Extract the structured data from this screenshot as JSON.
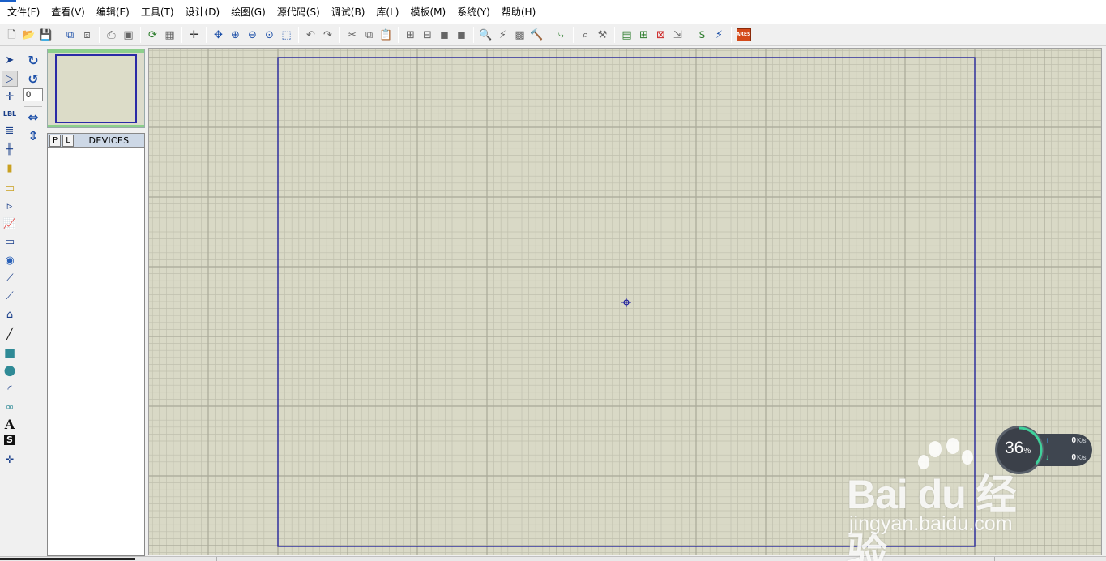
{
  "menu": {
    "items": [
      "文件(F)",
      "查看(V)",
      "编辑(E)",
      "工具(T)",
      "设计(D)",
      "绘图(G)",
      "源代码(S)",
      "调试(B)",
      "库(L)",
      "模板(M)",
      "系统(Y)",
      "帮助(H)"
    ]
  },
  "toolbar": {
    "groups": [
      [
        {
          "name": "new-file-icon",
          "glyph": "🗋",
          "color": "gray"
        },
        {
          "name": "open-folder-icon",
          "glyph": "📂",
          "color": ""
        },
        {
          "name": "save-icon",
          "glyph": "💾",
          "color": "blue"
        }
      ],
      [
        {
          "name": "import-section-icon",
          "glyph": "⧉",
          "color": "blue"
        },
        {
          "name": "export-section-icon",
          "glyph": "⧈",
          "color": "gray"
        }
      ],
      [
        {
          "name": "print-icon",
          "glyph": "⎙",
          "color": "gray"
        },
        {
          "name": "print-area-icon",
          "glyph": "▣",
          "color": "gray"
        }
      ],
      [
        {
          "name": "refresh-icon",
          "glyph": "⟳",
          "color": "green"
        },
        {
          "name": "grid-icon",
          "glyph": "▦",
          "color": "gray"
        }
      ],
      [
        {
          "name": "origin-icon",
          "glyph": "✛",
          "color": ""
        }
      ],
      [
        {
          "name": "pan-icon",
          "glyph": "✥",
          "color": "blue"
        },
        {
          "name": "zoom-in-icon",
          "glyph": "⊕",
          "color": "blue"
        },
        {
          "name": "zoom-out-icon",
          "glyph": "⊖",
          "color": "blue"
        },
        {
          "name": "zoom-all-icon",
          "glyph": "⊙",
          "color": "blue"
        },
        {
          "name": "zoom-area-icon",
          "glyph": "⬚",
          "color": "blue"
        }
      ],
      [
        {
          "name": "undo-icon",
          "glyph": "↶",
          "color": "gray"
        },
        {
          "name": "redo-icon",
          "glyph": "↷",
          "color": "gray"
        }
      ],
      [
        {
          "name": "cut-icon",
          "glyph": "✂",
          "color": "gray"
        },
        {
          "name": "copy-icon",
          "glyph": "⧉",
          "color": "gray"
        },
        {
          "name": "paste-icon",
          "glyph": "📋",
          "color": "gray"
        }
      ],
      [
        {
          "name": "block-copy-icon",
          "glyph": "⊞",
          "color": "gray"
        },
        {
          "name": "block-move-icon",
          "glyph": "⊟",
          "color": "gray"
        },
        {
          "name": "block-rotate-icon",
          "glyph": "◼",
          "color": "gray"
        },
        {
          "name": "block-delete-icon",
          "glyph": "◼",
          "color": "gray"
        }
      ],
      [
        {
          "name": "pick-device-icon",
          "glyph": "🔍",
          "color": "gray"
        },
        {
          "name": "make-device-icon",
          "glyph": "⚡",
          "color": "gray"
        },
        {
          "name": "packaging-icon",
          "glyph": "▩",
          "color": "gray"
        },
        {
          "name": "decompose-icon",
          "glyph": "🔨",
          "color": "gray"
        }
      ],
      [
        {
          "name": "wire-autorouter-icon",
          "glyph": "⤷",
          "color": "green"
        }
      ],
      [
        {
          "name": "search-tag-icon",
          "glyph": "⌕",
          "color": ""
        },
        {
          "name": "property-tool-icon",
          "glyph": "⚒",
          "color": "gray"
        }
      ],
      [
        {
          "name": "new-sheet-icon",
          "glyph": "▤",
          "color": "green"
        },
        {
          "name": "add-sheet-icon",
          "glyph": "⊞",
          "color": "green"
        },
        {
          "name": "remove-sheet-icon",
          "glyph": "⊠",
          "color": "red"
        },
        {
          "name": "goto-sheet-icon",
          "glyph": "⇲",
          "color": "gray"
        }
      ],
      [
        {
          "name": "bill-of-materials-icon",
          "glyph": "$",
          "color": "green"
        },
        {
          "name": "electrical-check-icon",
          "glyph": "⚡",
          "color": "blue"
        }
      ],
      [
        {
          "name": "ares-icon",
          "glyph": "ARES",
          "color": "ares"
        }
      ]
    ]
  },
  "left_tools": [
    {
      "name": "selection-mode-icon",
      "glyph": "➤",
      "selected": false
    },
    {
      "name": "component-mode-icon",
      "glyph": "▷",
      "selected": true
    },
    {
      "name": "junction-dot-icon",
      "glyph": "✛",
      "selected": false
    },
    {
      "name": "wire-label-icon",
      "glyph": "LBL",
      "selected": false
    },
    {
      "name": "text-script-icon",
      "glyph": "≣",
      "selected": false
    },
    {
      "name": "buses-icon",
      "glyph": "╫",
      "selected": false
    },
    {
      "name": "subcircuit-icon",
      "glyph": "▮",
      "selected": false
    },
    {
      "name": "terminals-icon",
      "glyph": "▭",
      "selected": false
    },
    {
      "name": "device-pins-icon",
      "glyph": "▹",
      "selected": false
    },
    {
      "name": "graph-icon",
      "glyph": "📈",
      "selected": false
    },
    {
      "name": "tape-recorder-icon",
      "glyph": "▭",
      "selected": false
    },
    {
      "name": "generator-icon",
      "glyph": "◉",
      "selected": false
    },
    {
      "name": "voltage-probe-icon",
      "glyph": "⟋",
      "selected": false
    },
    {
      "name": "current-probe-icon",
      "glyph": "⟋",
      "selected": false
    },
    {
      "name": "virtual-instruments-icon",
      "glyph": "⌂",
      "selected": false
    },
    {
      "name": "line-tool-icon",
      "glyph": "╱",
      "selected": false
    },
    {
      "name": "box-tool-icon",
      "glyph": "■",
      "selected": false
    },
    {
      "name": "circle-tool-icon",
      "glyph": "●",
      "selected": false
    },
    {
      "name": "arc-tool-icon",
      "glyph": "◜",
      "selected": false
    },
    {
      "name": "path-tool-icon",
      "glyph": "∞",
      "selected": false
    },
    {
      "name": "text-tool-icon",
      "glyph": "A",
      "selected": false
    },
    {
      "name": "symbol-tool-icon",
      "glyph": "S",
      "selected": false
    },
    {
      "name": "marker-tool-icon",
      "glyph": "✛",
      "selected": false
    }
  ],
  "rotation": {
    "angle_value": "0"
  },
  "device_panel": {
    "pick_button": "P",
    "library_button": "L",
    "title": "DEVICES"
  },
  "net_monitor": {
    "percent": "36",
    "percent_suffix": "%",
    "upload_value": "0",
    "download_value": "0",
    "unit": "K/s"
  },
  "watermark": {
    "logo": "Bai  du 经验",
    "url": "jingyan.baidu.com"
  },
  "colors": {
    "canvas_bg": "#d9d9c6",
    "grid_minor": "#c0c0ae",
    "grid_major": "#a9a998",
    "sheet_border": "#1c1c9c",
    "origin_marker": "#1c1c9c"
  }
}
